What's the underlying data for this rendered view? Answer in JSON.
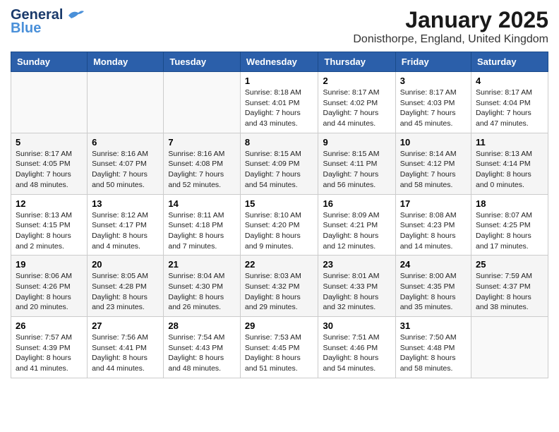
{
  "header": {
    "logo_general": "General",
    "logo_blue": "Blue",
    "month_title": "January 2025",
    "location": "Donisthorpe, England, United Kingdom"
  },
  "weekdays": [
    "Sunday",
    "Monday",
    "Tuesday",
    "Wednesday",
    "Thursday",
    "Friday",
    "Saturday"
  ],
  "weeks": [
    [
      {
        "day": "",
        "sunrise": "",
        "sunset": "",
        "daylight": ""
      },
      {
        "day": "",
        "sunrise": "",
        "sunset": "",
        "daylight": ""
      },
      {
        "day": "",
        "sunrise": "",
        "sunset": "",
        "daylight": ""
      },
      {
        "day": "1",
        "sunrise": "Sunrise: 8:18 AM",
        "sunset": "Sunset: 4:01 PM",
        "daylight": "Daylight: 7 hours and 43 minutes."
      },
      {
        "day": "2",
        "sunrise": "Sunrise: 8:17 AM",
        "sunset": "Sunset: 4:02 PM",
        "daylight": "Daylight: 7 hours and 44 minutes."
      },
      {
        "day": "3",
        "sunrise": "Sunrise: 8:17 AM",
        "sunset": "Sunset: 4:03 PM",
        "daylight": "Daylight: 7 hours and 45 minutes."
      },
      {
        "day": "4",
        "sunrise": "Sunrise: 8:17 AM",
        "sunset": "Sunset: 4:04 PM",
        "daylight": "Daylight: 7 hours and 47 minutes."
      }
    ],
    [
      {
        "day": "5",
        "sunrise": "Sunrise: 8:17 AM",
        "sunset": "Sunset: 4:05 PM",
        "daylight": "Daylight: 7 hours and 48 minutes."
      },
      {
        "day": "6",
        "sunrise": "Sunrise: 8:16 AM",
        "sunset": "Sunset: 4:07 PM",
        "daylight": "Daylight: 7 hours and 50 minutes."
      },
      {
        "day": "7",
        "sunrise": "Sunrise: 8:16 AM",
        "sunset": "Sunset: 4:08 PM",
        "daylight": "Daylight: 7 hours and 52 minutes."
      },
      {
        "day": "8",
        "sunrise": "Sunrise: 8:15 AM",
        "sunset": "Sunset: 4:09 PM",
        "daylight": "Daylight: 7 hours and 54 minutes."
      },
      {
        "day": "9",
        "sunrise": "Sunrise: 8:15 AM",
        "sunset": "Sunset: 4:11 PM",
        "daylight": "Daylight: 7 hours and 56 minutes."
      },
      {
        "day": "10",
        "sunrise": "Sunrise: 8:14 AM",
        "sunset": "Sunset: 4:12 PM",
        "daylight": "Daylight: 7 hours and 58 minutes."
      },
      {
        "day": "11",
        "sunrise": "Sunrise: 8:13 AM",
        "sunset": "Sunset: 4:14 PM",
        "daylight": "Daylight: 8 hours and 0 minutes."
      }
    ],
    [
      {
        "day": "12",
        "sunrise": "Sunrise: 8:13 AM",
        "sunset": "Sunset: 4:15 PM",
        "daylight": "Daylight: 8 hours and 2 minutes."
      },
      {
        "day": "13",
        "sunrise": "Sunrise: 8:12 AM",
        "sunset": "Sunset: 4:17 PM",
        "daylight": "Daylight: 8 hours and 4 minutes."
      },
      {
        "day": "14",
        "sunrise": "Sunrise: 8:11 AM",
        "sunset": "Sunset: 4:18 PM",
        "daylight": "Daylight: 8 hours and 7 minutes."
      },
      {
        "day": "15",
        "sunrise": "Sunrise: 8:10 AM",
        "sunset": "Sunset: 4:20 PM",
        "daylight": "Daylight: 8 hours and 9 minutes."
      },
      {
        "day": "16",
        "sunrise": "Sunrise: 8:09 AM",
        "sunset": "Sunset: 4:21 PM",
        "daylight": "Daylight: 8 hours and 12 minutes."
      },
      {
        "day": "17",
        "sunrise": "Sunrise: 8:08 AM",
        "sunset": "Sunset: 4:23 PM",
        "daylight": "Daylight: 8 hours and 14 minutes."
      },
      {
        "day": "18",
        "sunrise": "Sunrise: 8:07 AM",
        "sunset": "Sunset: 4:25 PM",
        "daylight": "Daylight: 8 hours and 17 minutes."
      }
    ],
    [
      {
        "day": "19",
        "sunrise": "Sunrise: 8:06 AM",
        "sunset": "Sunset: 4:26 PM",
        "daylight": "Daylight: 8 hours and 20 minutes."
      },
      {
        "day": "20",
        "sunrise": "Sunrise: 8:05 AM",
        "sunset": "Sunset: 4:28 PM",
        "daylight": "Daylight: 8 hours and 23 minutes."
      },
      {
        "day": "21",
        "sunrise": "Sunrise: 8:04 AM",
        "sunset": "Sunset: 4:30 PM",
        "daylight": "Daylight: 8 hours and 26 minutes."
      },
      {
        "day": "22",
        "sunrise": "Sunrise: 8:03 AM",
        "sunset": "Sunset: 4:32 PM",
        "daylight": "Daylight: 8 hours and 29 minutes."
      },
      {
        "day": "23",
        "sunrise": "Sunrise: 8:01 AM",
        "sunset": "Sunset: 4:33 PM",
        "daylight": "Daylight: 8 hours and 32 minutes."
      },
      {
        "day": "24",
        "sunrise": "Sunrise: 8:00 AM",
        "sunset": "Sunset: 4:35 PM",
        "daylight": "Daylight: 8 hours and 35 minutes."
      },
      {
        "day": "25",
        "sunrise": "Sunrise: 7:59 AM",
        "sunset": "Sunset: 4:37 PM",
        "daylight": "Daylight: 8 hours and 38 minutes."
      }
    ],
    [
      {
        "day": "26",
        "sunrise": "Sunrise: 7:57 AM",
        "sunset": "Sunset: 4:39 PM",
        "daylight": "Daylight: 8 hours and 41 minutes."
      },
      {
        "day": "27",
        "sunrise": "Sunrise: 7:56 AM",
        "sunset": "Sunset: 4:41 PM",
        "daylight": "Daylight: 8 hours and 44 minutes."
      },
      {
        "day": "28",
        "sunrise": "Sunrise: 7:54 AM",
        "sunset": "Sunset: 4:43 PM",
        "daylight": "Daylight: 8 hours and 48 minutes."
      },
      {
        "day": "29",
        "sunrise": "Sunrise: 7:53 AM",
        "sunset": "Sunset: 4:45 PM",
        "daylight": "Daylight: 8 hours and 51 minutes."
      },
      {
        "day": "30",
        "sunrise": "Sunrise: 7:51 AM",
        "sunset": "Sunset: 4:46 PM",
        "daylight": "Daylight: 8 hours and 54 minutes."
      },
      {
        "day": "31",
        "sunrise": "Sunrise: 7:50 AM",
        "sunset": "Sunset: 4:48 PM",
        "daylight": "Daylight: 8 hours and 58 minutes."
      },
      {
        "day": "",
        "sunrise": "",
        "sunset": "",
        "daylight": ""
      }
    ]
  ]
}
